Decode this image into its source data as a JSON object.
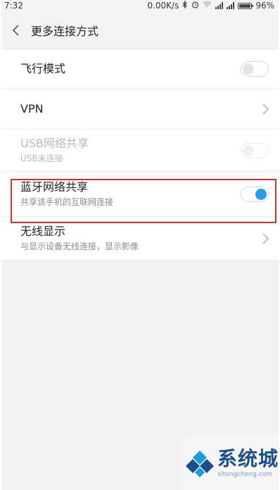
{
  "status_bar": {
    "time": "7:32",
    "speed": "0.00K/s",
    "battery_percent": "96%",
    "battery_level": 0.96
  },
  "header": {
    "back_icon": "chevron-left-icon",
    "title": "更多连接方式"
  },
  "items": [
    {
      "label": "飞行模式",
      "sub": "",
      "control": "toggle",
      "state": "off",
      "enabled": true
    },
    {
      "label": "VPN",
      "sub": "",
      "control": "chevron",
      "enabled": true
    },
    {
      "label": "USB网络共享",
      "sub": "USB未连接",
      "control": "toggle",
      "state": "off",
      "enabled": false
    },
    {
      "label": "蓝牙网络共享",
      "sub": "共享该手机的互联网连接",
      "control": "toggle",
      "state": "on",
      "enabled": true
    },
    {
      "label": "无线显示",
      "sub": "与显示设备无线连接，显示影像",
      "control": "chevron",
      "enabled": true
    }
  ],
  "colors": {
    "accent": "#2b9ae8",
    "highlight_box": "#d42f2f",
    "watermark_blue": "#1b4f8c"
  },
  "watermark": {
    "main": "系统城",
    "sub": "xitongcheng.com"
  }
}
